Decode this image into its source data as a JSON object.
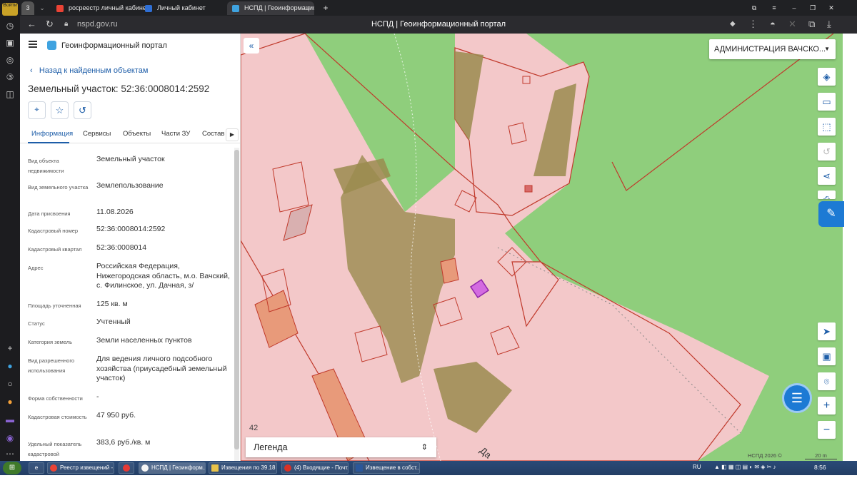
{
  "browser": {
    "tabs": [
      {
        "label": "3"
      },
      {
        "label": "росреестр личный кабинет",
        "color": "#ea4335"
      },
      {
        "label": "Личный кабинет",
        "color": "#2f6fd5"
      },
      {
        "label": "НСПД | Геоинформационный портал",
        "color": "#3fa3e0"
      }
    ],
    "url": "nspd.gov.ru",
    "page_title": "НСПД | Геоинформационный портал",
    "login_label": "Войти"
  },
  "portal": {
    "name": "Геоинформационный портал",
    "back_link": "Назад к найденным объектам",
    "title": "Земельный участок: 52:36:0008014:2592",
    "tabs": [
      "Информация",
      "Сервисы",
      "Объекты",
      "Части ЗУ",
      "Состав"
    ],
    "fields": [
      {
        "key": "Вид объекта недвижимости",
        "value": "Земельный участок"
      },
      {
        "key": "Вид земельного участка",
        "value": "Землепользование"
      },
      {
        "key": "Дата присвоения",
        "value": "11.08.2026"
      },
      {
        "key": "Кадастровый номер",
        "value": "52:36:0008014:2592"
      },
      {
        "key": "Кадастровый квартал",
        "value": "52:36:0008014"
      },
      {
        "key": "Адрес",
        "value": "Российская Федерация, Нижегородская область, м.о. Вачский, с. Филинское, ул. Дачная, з/"
      },
      {
        "key": "Площадь уточненная",
        "value": "125 кв. м"
      },
      {
        "key": "Статус",
        "value": "Учтенный"
      },
      {
        "key": "Категория земель",
        "value": "Земли населенных пунктов"
      },
      {
        "key": "Вид разрешенного использования",
        "value": "Для ведения личного подсобного хозяйства (приусадебный земельный участок)"
      },
      {
        "key": "Форма собственности",
        "value": "-"
      },
      {
        "key": "Кадастровая стоимость",
        "value": "47 950 руб."
      },
      {
        "key": "Удельный показатель кадастровой",
        "value": "383,6 руб./кв. м"
      }
    ]
  },
  "map": {
    "admin_select": "АДМИНИСТРАЦИЯ ВАЧСКО...",
    "legend": "Легенда",
    "copyright": "НСПД 2026 ©",
    "scale": "20 m",
    "map_labels": [
      "42",
      "Да"
    ],
    "colors": {
      "parcel": "#f3c8c9",
      "forest": "#8fce7c",
      "olive": "#9a8b4f",
      "border": "#c0392b",
      "selected": "#8e24aa"
    },
    "tool_icons": [
      "layers-icon",
      "ruler-icon",
      "select-area-icon",
      "history-icon",
      "share-icon",
      "print-icon",
      "locate-icon",
      "picture-in-picture-icon",
      "pin-icon",
      "zoom-in-icon",
      "zoom-out-icon"
    ]
  },
  "taskbar": {
    "items": [
      "Реестр извещений -...",
      "",
      "НСПД | Геоинформ...",
      "Извещения по 39.18",
      "(4) Входящие - Почт...",
      "Извещение в собст..."
    ],
    "lang": "RU",
    "clock": "8:56"
  }
}
